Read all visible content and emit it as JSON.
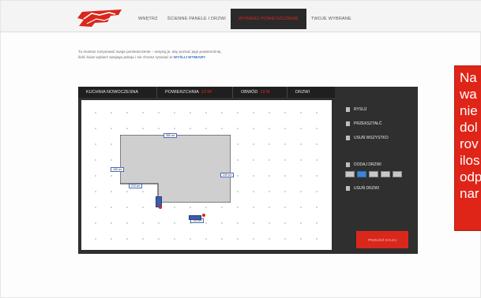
{
  "header": {
    "logo_text": "ZOOM",
    "nav": [
      {
        "label": "WNĘTRZ",
        "active": false
      },
      {
        "label": "ŚCIENNE PANELE I DRZWI",
        "active": false
      },
      {
        "label": "WYBIERZ POMIESZCZENIE",
        "active": true
      },
      {
        "label": "TWOJE WYBRANE",
        "active": false
      }
    ]
  },
  "intro": {
    "text": "Tu możesz rozrysować swoje pomieszczenie – narysuj je, aby poznać jego powierzchnię, ilość ścian wybierz swojego pokoju i nie chcesz rysować to",
    "link": "WYŚLIJ WYMIARY"
  },
  "editor": {
    "tabs": [
      {
        "label": "KUCHNIA NOWOCZESNA",
        "accent": ""
      },
      {
        "label": "POWIERZCHNIA",
        "accent": "23 m²"
      },
      {
        "label": "OBWÓD",
        "accent": "19 m"
      },
      {
        "label": "DRZWI",
        "accent": ""
      }
    ],
    "measurements": {
      "top": "380 cm",
      "left": "180 cm",
      "inner": "210 cm",
      "right": "240 cm",
      "bottom": "100 cm"
    },
    "tools": [
      {
        "label": "RYSUJ",
        "icon": "pencil-icon"
      },
      {
        "label": "PRZEKSZTAŁĆ",
        "icon": "transform-icon"
      },
      {
        "label": "USUŃ WSZYSTKO",
        "icon": "trash-icon"
      },
      {
        "label": "DODAJ DRZWI",
        "icon": "door-icon"
      },
      {
        "label": "USUŃ DRZWI",
        "icon": "trash-icon"
      }
    ],
    "door_size_count_selected": 2,
    "next_label": "PRZEJDŹ DALEJ"
  },
  "callout": {
    "lines": [
      "Na",
      "wa",
      "nie",
      "dol",
      "rov",
      "ilos",
      "odp",
      "nar"
    ]
  },
  "colors": {
    "accent": "#df2418",
    "panel": "#2f2f2f",
    "room_fill": "#cfcfcf",
    "door": "#3c5ea6"
  }
}
